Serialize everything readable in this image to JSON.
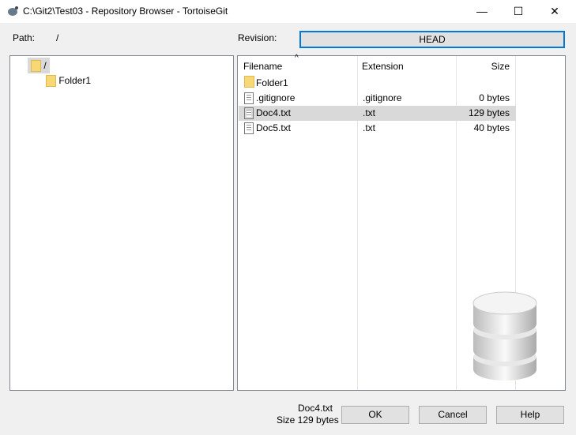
{
  "window": {
    "title": "C:\\Git2\\Test03 - Repository Browser - TortoiseGit",
    "minimize": "—",
    "maximize": "☐",
    "close": "✕"
  },
  "path": {
    "label": "Path:",
    "value": "/"
  },
  "revision": {
    "label": "Revision:",
    "value": "HEAD"
  },
  "tree": [
    {
      "label": "/"
    },
    {
      "label": "Folder1"
    }
  ],
  "list": {
    "headers": {
      "filename": "Filename",
      "extension": "Extension",
      "size": "Size"
    },
    "rows": [
      {
        "name": "Folder1",
        "ext": "",
        "size": "",
        "icon": "folder"
      },
      {
        "name": ".gitignore",
        "ext": ".gitignore",
        "size": "0 bytes",
        "icon": "text-edit"
      },
      {
        "name": "Doc4.txt",
        "ext": ".txt",
        "size": "129 bytes",
        "icon": "document",
        "selected": true
      },
      {
        "name": "Doc5.txt",
        "ext": ".txt",
        "size": "40 bytes",
        "icon": "document"
      }
    ]
  },
  "status": {
    "file": "Doc4.txt",
    "size": "Size 129 bytes"
  },
  "buttons": {
    "ok": "OK",
    "cancel": "Cancel",
    "help": "Help"
  }
}
